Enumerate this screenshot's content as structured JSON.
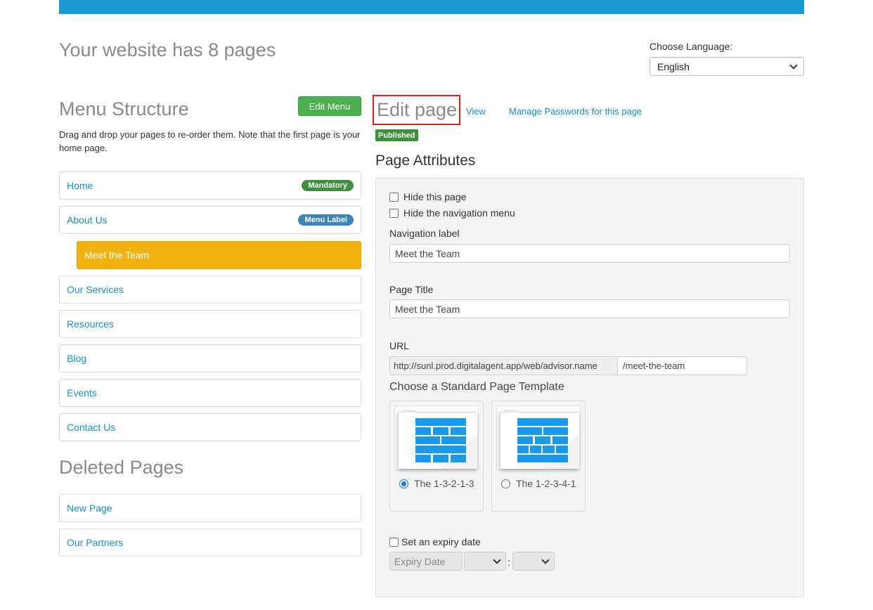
{
  "header": {
    "page_count_text": "Your website has 8 pages",
    "language_label": "Choose Language:",
    "language_selected": "English"
  },
  "menu": {
    "title": "Menu Structure",
    "edit_button": "Edit Menu",
    "description": "Drag and drop your pages to re-order them. Note that the first page is your home page.",
    "items": [
      {
        "label": "Home",
        "badge": "Mandatory"
      },
      {
        "label": "About Us",
        "badge": "Menu Label"
      },
      {
        "label": "Meet the Team",
        "badge": ""
      },
      {
        "label": "Our Services",
        "badge": ""
      },
      {
        "label": "Resources",
        "badge": ""
      },
      {
        "label": "Blog",
        "badge": ""
      },
      {
        "label": "Events",
        "badge": ""
      },
      {
        "label": "Contact Us",
        "badge": ""
      }
    ]
  },
  "deleted": {
    "title": "Deleted Pages",
    "items": [
      {
        "label": "New Page"
      },
      {
        "label": "Our Partners"
      }
    ]
  },
  "edit": {
    "title": "Edit page",
    "view_link": "View",
    "passwords_link": "Manage Passwords for this page",
    "status_badge": "Published",
    "attributes_title": "Page Attributes",
    "hide_page_label": "Hide this page",
    "hide_nav_label": "Hide the navigation menu",
    "nav_label_label": "Navigation label",
    "nav_label_value": "Meet the Team",
    "page_title_label": "Page Title",
    "page_title_value": "Meet the Team",
    "url_label": "URL",
    "url_prefix": "http://sunl.prod.digitalagent.app/web/advisor.name",
    "url_slug": "/meet-the-team",
    "template_title": "Choose a Standard Page Template",
    "templates": [
      {
        "label": "The 1-3-2-1-3",
        "selected": true
      },
      {
        "label": "The 1-2-3-4-1",
        "selected": false
      }
    ],
    "expiry_label": "Set an expiry date",
    "expiry_placeholder": "Expiry Date",
    "time_separator": ":"
  },
  "colors": {
    "accent_blue": "#1a9ad6",
    "link": "#1a8fc4",
    "active_item": "#f0b20e",
    "success": "#4cae4c",
    "tile_blue": "#1a9ae8"
  }
}
